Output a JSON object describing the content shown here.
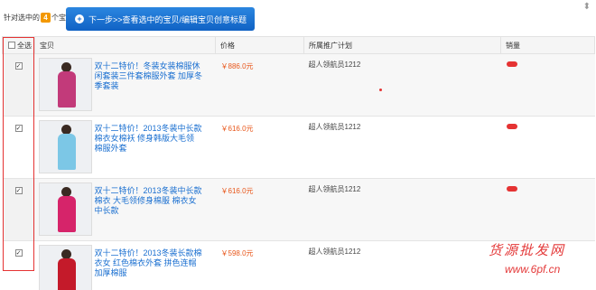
{
  "toolbar": {
    "label_prefix": "针对选中的",
    "selected_count": "4",
    "label_suffix": "个宝贝",
    "next_button": "下一步>>查看选中的宝贝/编辑宝贝创意标题"
  },
  "table": {
    "select_all": "全选",
    "columns": {
      "item": "宝贝",
      "price": "价格",
      "plan": "所属推广计划",
      "sales": "销量"
    },
    "rows": [
      {
        "checked": true,
        "title": "双十二特价！冬装女装棉服休闲套装三件套棉服外套 加厚冬季套装",
        "price": "￥886.0元",
        "plan": "超人领航员1212",
        "photo_color": "#c23a7a",
        "sales_hidden": true
      },
      {
        "checked": true,
        "title": "双十二特价！2013冬装中长款棉衣女棉袄 修身韩版大毛领 棉服外套",
        "price": "￥616.0元",
        "plan": "超人领航员1212",
        "photo_color": "#7cc7e6",
        "sales_hidden": true
      },
      {
        "checked": true,
        "title": "双十二特价！2013冬装中长款棉衣 大毛领修身棉服 棉衣女中长款",
        "price": "￥616.0元",
        "plan": "超人领航员1212",
        "photo_color": "#d6246a",
        "sales_hidden": true
      },
      {
        "checked": true,
        "title": "双十二特价！2013冬装长款棉衣女 红色棉衣外套 拼色连帽加厚棉服",
        "price": "￥598.0元",
        "plan": "超人领航员1212",
        "photo_color": "#c41a2a",
        "sales_hidden": false
      }
    ]
  },
  "watermark": {
    "text": "货源批发网",
    "url": "www.6pf.cn"
  },
  "colors": {
    "button": "#1a6fd0",
    "price": "#e8571b",
    "highlight": "#e53333",
    "badge": "#f39800"
  }
}
